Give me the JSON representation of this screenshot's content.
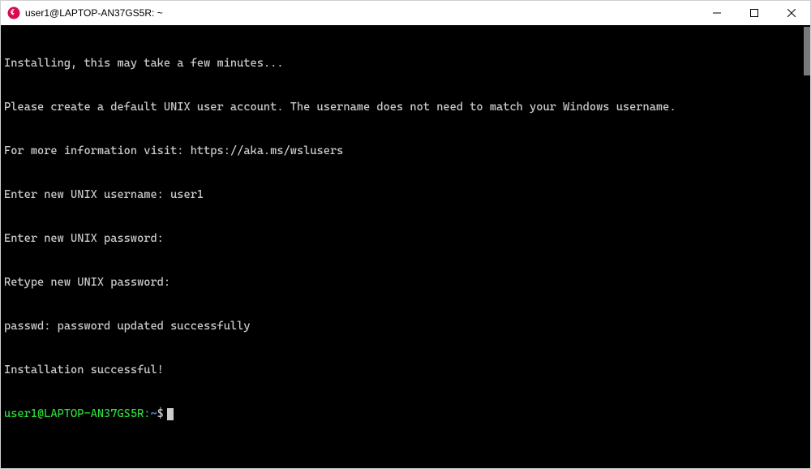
{
  "window": {
    "title": "user1@LAPTOP-AN37GS5R: ~"
  },
  "terminal": {
    "lines": [
      "Installing, this may take a few minutes...",
      "Please create a default UNIX user account. The username does not need to match your Windows username.",
      "For more information visit: https://aka.ms/wslusers",
      "Enter new UNIX username: user1",
      "Enter new UNIX password:",
      "Retype new UNIX password:",
      "passwd: password updated successfully",
      "Installation successful!"
    ],
    "prompt": {
      "user_host": "user1@LAPTOP-AN37GS5R",
      "colon": ":",
      "path": "~",
      "dollar": "$"
    }
  }
}
